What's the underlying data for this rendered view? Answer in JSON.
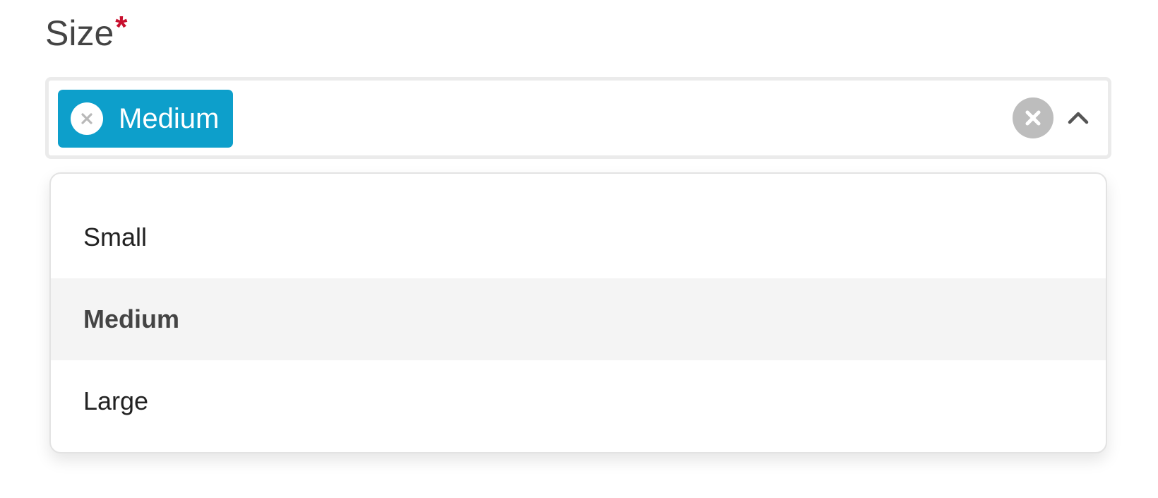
{
  "field": {
    "label": "Size",
    "required_marker": "*"
  },
  "select": {
    "selected_chips": [
      {
        "label": "Medium"
      }
    ],
    "expanded": true,
    "icons": {
      "chip_remove": "close-icon",
      "clear_all": "close-circle-icon",
      "toggle": "chevron-up-icon"
    }
  },
  "dropdown": {
    "options": [
      {
        "label": "Small",
        "selected": false
      },
      {
        "label": "Medium",
        "selected": true
      },
      {
        "label": "Large",
        "selected": false
      }
    ]
  },
  "colors": {
    "chip_background": "#0d9fcb",
    "required_star": "#c8102e",
    "selected_option_background": "#f4f4f4",
    "clear_icon_background": "#bdbdbd"
  }
}
